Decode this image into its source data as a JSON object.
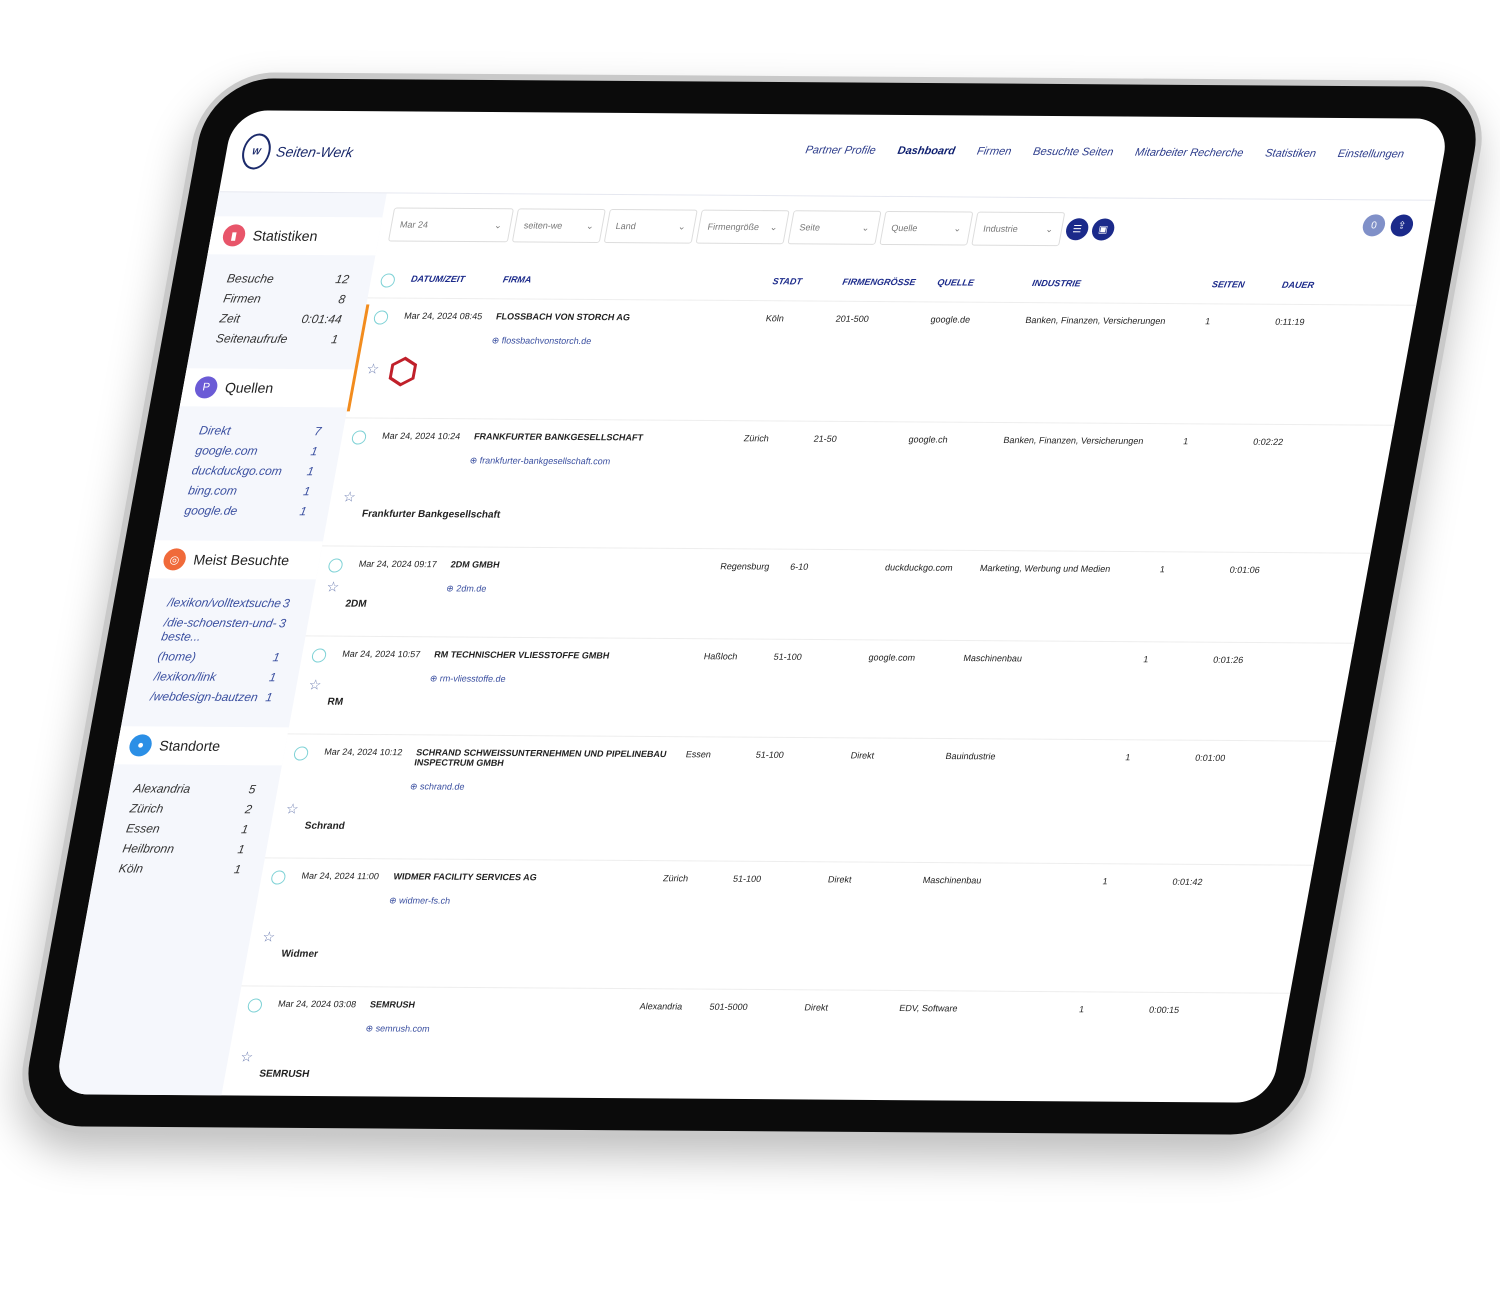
{
  "brand": {
    "name": "Seiten-Werk",
    "mark": "Werk"
  },
  "nav": [
    "Partner Profile",
    "Dashboard",
    "Firmen",
    "Besuchte Seiten",
    "Mitarbeiter Recherche",
    "Statistiken",
    "Einstellungen"
  ],
  "nav_active": "Dashboard",
  "filters": [
    "Mar 24",
    "seiten-we",
    "Land",
    "Firmengröße",
    "Seite",
    "Quelle",
    "Industrie"
  ],
  "sidebar": {
    "statistiken": {
      "title": "Statistiken",
      "items": [
        {
          "label": "Besuche",
          "value": "12"
        },
        {
          "label": "Firmen",
          "value": "8"
        },
        {
          "label": "Zeit",
          "value": "0:01:44"
        },
        {
          "label": "Seitenaufrufe",
          "value": "1"
        }
      ]
    },
    "quellen": {
      "title": "Quellen",
      "items": [
        {
          "label": "Direkt",
          "value": "7"
        },
        {
          "label": "google.com",
          "value": "1"
        },
        {
          "label": "duckduckgo.com",
          "value": "1"
        },
        {
          "label": "bing.com",
          "value": "1"
        },
        {
          "label": "google.de",
          "value": "1"
        }
      ]
    },
    "meist": {
      "title": "Meist Besuchte",
      "items": [
        {
          "label": "/lexikon/volltextsuche",
          "value": "3"
        },
        {
          "label": "/die-schoensten-und-beste...",
          "value": "3"
        },
        {
          "label": "(home)",
          "value": "1"
        },
        {
          "label": "/lexikon/link",
          "value": "1"
        },
        {
          "label": "/webdesign-bautzen",
          "value": "1"
        }
      ]
    },
    "standorte": {
      "title": "Standorte",
      "items": [
        {
          "label": "Alexandria",
          "value": "5"
        },
        {
          "label": "Zürich",
          "value": "2"
        },
        {
          "label": "Essen",
          "value": "1"
        },
        {
          "label": "Heilbronn",
          "value": "1"
        },
        {
          "label": "Köln",
          "value": "1"
        }
      ]
    }
  },
  "columns": [
    "DATUM/ZEIT",
    "FIRMA",
    "STADT",
    "FIRMENGRÖSSE",
    "QUELLE",
    "INDUSTRIE",
    "SEITEN",
    "DAUER"
  ],
  "rows": [
    {
      "date": "Mar 24, 2024 08:45",
      "firm": "FLOSSBACH VON STORCH AG",
      "url": "flossbachvonstorch.de",
      "city": "Köln",
      "size": "201-500",
      "source": "google.de",
      "industry": "Banken, Finanzen, Versicherungen",
      "pages": "1",
      "duration": "0:11:19"
    },
    {
      "date": "Mar 24, 2024 10:24",
      "firm": "FRANKFURTER BANKGESELLSCHAFT",
      "url": "frankfurter-bankgesellschaft.com",
      "city": "Zürich",
      "size": "21-50",
      "source": "google.ch",
      "industry": "Banken, Finanzen, Versicherungen",
      "pages": "1",
      "duration": "0:02:22"
    },
    {
      "date": "Mar 24, 2024 09:17",
      "firm": "2DM GMBH",
      "url": "2dm.de",
      "city": "Regensburg",
      "size": "6-10",
      "source": "duckduckgo.com",
      "industry": "Marketing, Werbung und Medien",
      "pages": "1",
      "duration": "0:01:06"
    },
    {
      "date": "Mar 24, 2024 10:57",
      "firm": "RM TECHNISCHER VLIESSTOFFE GMBH",
      "url": "rm-vliesstoffe.de",
      "city": "Haßloch",
      "size": "51-100",
      "source": "google.com",
      "industry": "Maschinenbau",
      "pages": "1",
      "duration": "0:01:26"
    },
    {
      "date": "Mar 24, 2024 10:12",
      "firm": "SCHRAND SCHWEISSUNTERNEHMEN UND PIPELINEBAU INSPECTRUM GMBH",
      "url": "schrand.de",
      "city": "Essen",
      "size": "51-100",
      "source": "Direkt",
      "industry": "Bauindustrie",
      "pages": "1",
      "duration": "0:01:00"
    },
    {
      "date": "Mar 24, 2024 11:00",
      "firm": "WIDMER FACILITY SERVICES AG",
      "url": "widmer-fs.ch",
      "city": "Zürich",
      "size": "51-100",
      "source": "Direkt",
      "industry": "Maschinenbau",
      "pages": "1",
      "duration": "0:01:42"
    },
    {
      "date": "Mar 24, 2024 03:08",
      "firm": "SEMRUSH",
      "url": "semrush.com",
      "city": "Alexandria",
      "size": "501-5000",
      "source": "Direkt",
      "industry": "EDV, Software",
      "pages": "1",
      "duration": "0:00:15"
    }
  ],
  "logos": [
    "Flossbach von Storch",
    "Frankfurter Bankgesellschaft",
    "2DM",
    "RM",
    "Schrand",
    "Widmer",
    "SEMRUSH"
  ],
  "colors": {
    "accent": "#1b2a8a",
    "highlight": "#f28c1e"
  }
}
